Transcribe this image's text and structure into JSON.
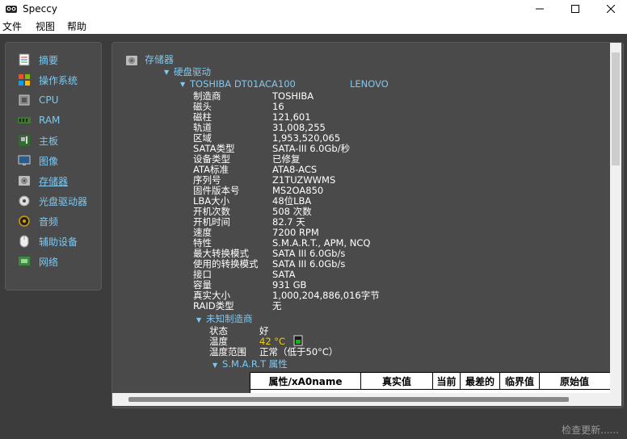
{
  "window": {
    "title": "Speccy"
  },
  "menu": [
    "文件",
    "视图",
    "帮助"
  ],
  "sidebar": {
    "items": [
      {
        "label": "摘要",
        "icon": "summary-icon"
      },
      {
        "label": "操作系统",
        "icon": "windows-icon"
      },
      {
        "label": "CPU",
        "icon": "cpu-icon"
      },
      {
        "label": "RAM",
        "icon": "ram-icon"
      },
      {
        "label": "主板",
        "icon": "motherboard-icon"
      },
      {
        "label": "图像",
        "icon": "monitor-icon"
      },
      {
        "label": "存储器",
        "icon": "storage-icon"
      },
      {
        "label": "光盘驱动器",
        "icon": "optical-icon"
      },
      {
        "label": "音频",
        "icon": "audio-icon"
      },
      {
        "label": "辅助设备",
        "icon": "mouse-icon"
      },
      {
        "label": "网络",
        "icon": "network-icon"
      }
    ]
  },
  "main": {
    "section_title": "存储器",
    "subsection": "硬盘驱动",
    "drive_name": "TOSHIBA DT01ACA100",
    "drive_vendor": "LENOVO",
    "properties": [
      {
        "label": "制造商",
        "value": "TOSHIBA"
      },
      {
        "label": "磁头",
        "value": "16"
      },
      {
        "label": "磁柱",
        "value": "121,601"
      },
      {
        "label": "轨道",
        "value": "31,008,255"
      },
      {
        "label": "区域",
        "value": "1,953,520,065"
      },
      {
        "label": "SATA类型",
        "value": "SATA-III 6.0Gb/秒"
      },
      {
        "label": "设备类型",
        "value": "已修复"
      },
      {
        "label": "ATA标准",
        "value": "ATA8-ACS"
      },
      {
        "label": "序列号",
        "value": "Z1TUZWWMS"
      },
      {
        "label": "固件版本号",
        "value": "MS2OA850"
      },
      {
        "label": "LBA大小",
        "value": "48位LBA"
      },
      {
        "label": "开机次数",
        "value": "508 次数"
      },
      {
        "label": "开机时间",
        "value": "82.7 天"
      },
      {
        "label": "速度",
        "value": "7200 RPM"
      },
      {
        "label": "特性",
        "value": "S.M.A.R.T., APM, NCQ"
      },
      {
        "label": "最大转换模式",
        "value": "SATA III 6.0Gb/s"
      },
      {
        "label": "使用的转换模式",
        "value": "SATA III 6.0Gb/s"
      },
      {
        "label": "接口",
        "value": "SATA"
      },
      {
        "label": "容量",
        "value": "931 GB"
      },
      {
        "label": "真实大小",
        "value": "1,000,204,886,016字节"
      },
      {
        "label": "RAID类型",
        "value": "无"
      }
    ],
    "manufacturer_section": "未知制造商",
    "status": [
      {
        "label": "状态",
        "value": "好"
      },
      {
        "label": "温度",
        "value": "42 °C"
      },
      {
        "label": "温度范围",
        "value": "正常（低于50°C）"
      }
    ],
    "smart_title": "S.M.A.R.T 属性",
    "smart_columns": [
      "属性/xA0name",
      "真实值",
      "当前",
      "最差的",
      "临界值",
      "原始值"
    ]
  },
  "footer": {
    "update_text": "检查更新......"
  },
  "colors": {
    "accent": "#7fc8f0",
    "temperature": "#f0d000",
    "status_ok": "#00c000"
  }
}
